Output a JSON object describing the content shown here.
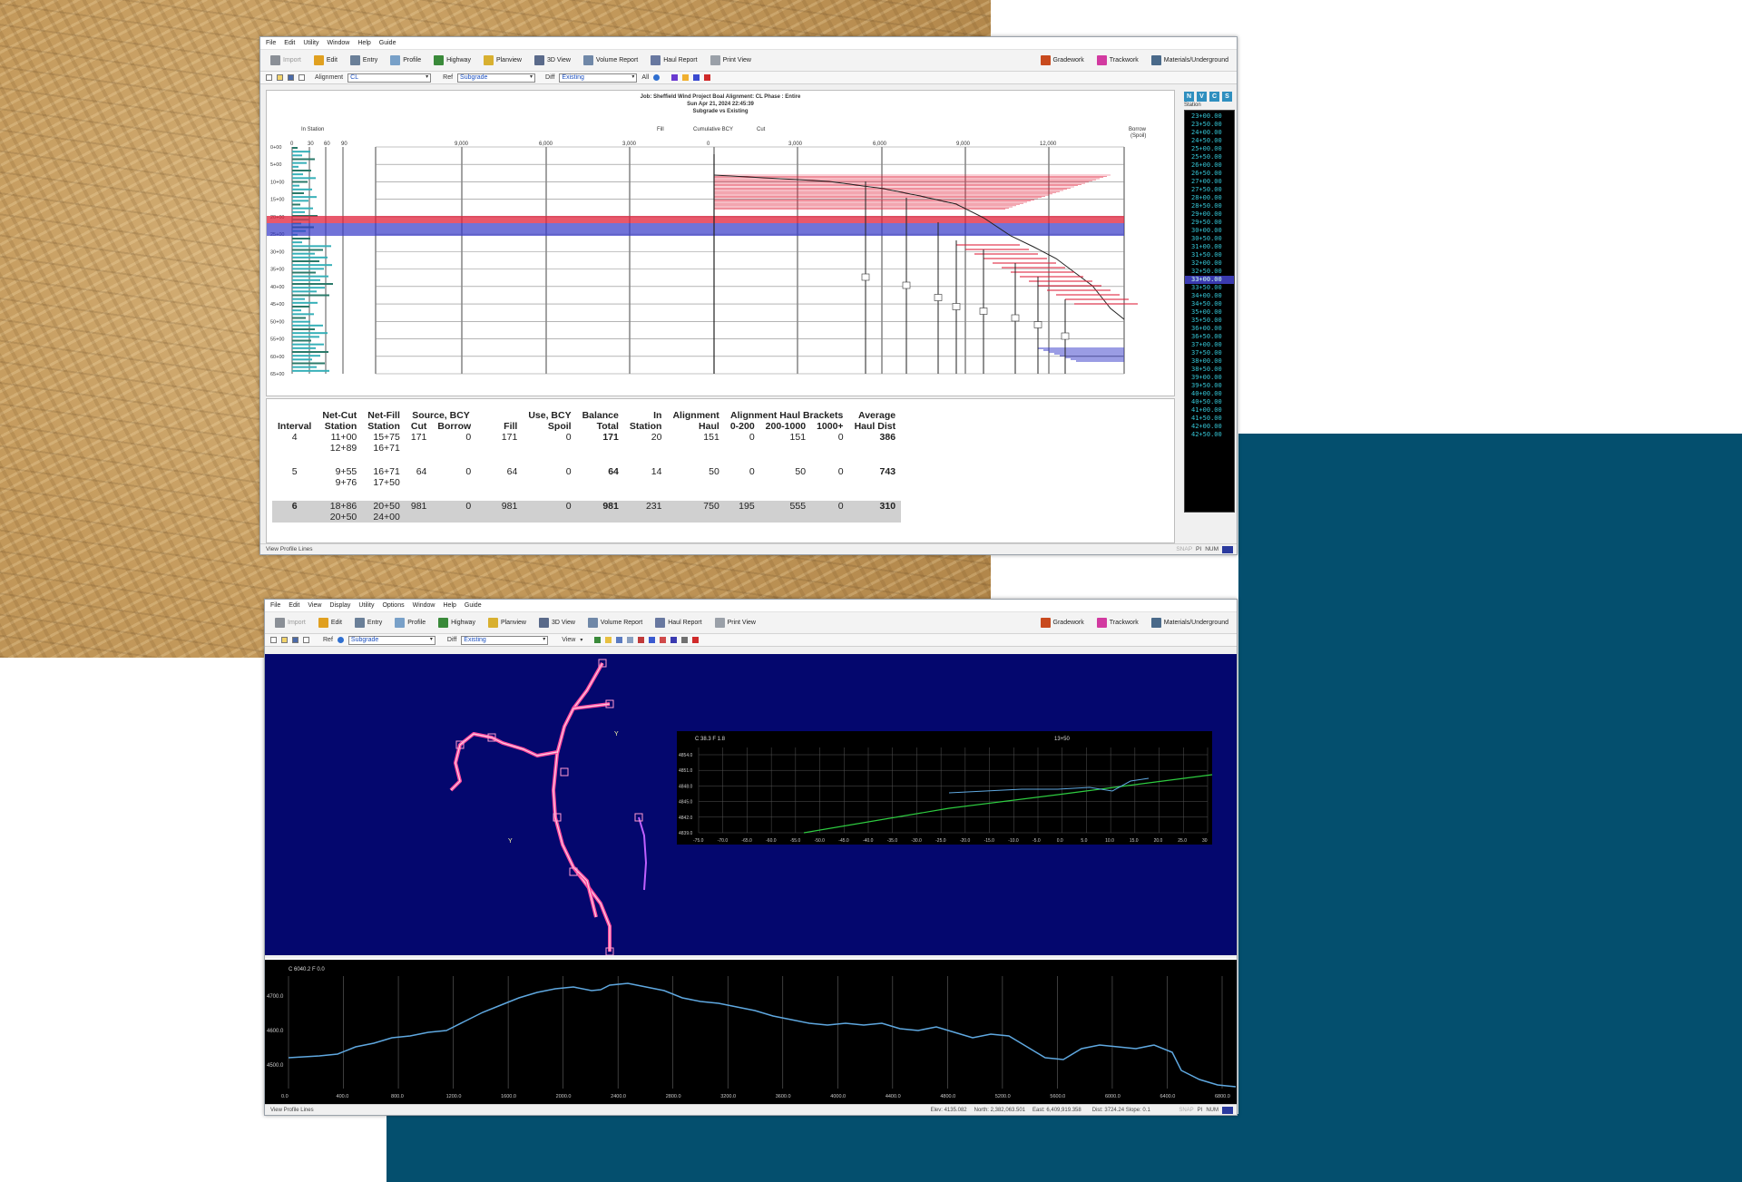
{
  "window1": {
    "menu": [
      "File",
      "Edit",
      "Utility",
      "Window",
      "Help",
      "Guide"
    ],
    "toolbar": [
      "Import",
      "Edit",
      "Entry",
      "Profile",
      "Highway",
      "Planview",
      "3D View",
      "Volume Report",
      "Haul Report",
      "Print View"
    ],
    "toolbar_right": [
      "Gradework",
      "Trackwork",
      "Materials/Underground"
    ],
    "options": {
      "alignment_label": "Alignment",
      "alignment_value": "CL",
      "ref_label": "Ref",
      "ref_value": "Subgrade",
      "diff_label": "Diff",
      "diff_value": "Existing",
      "all_label": "All"
    },
    "mass_header": {
      "line1": "Job: Sheffield Wind Project Boal   Alignment: CL    Phase : Entire",
      "line2": "Sun Apr 21, 2024 22:45:39",
      "line3": "Subgrade vs Existing"
    },
    "mass_labels": {
      "in_station": "In Station",
      "fill": "Fill",
      "cumulative": "Cumulative BCY",
      "cut": "Cut",
      "borrow": "Borrow",
      "spoil": "(Spoil)"
    },
    "mass_ticks_left": [
      "0",
      "30",
      "60",
      "90"
    ],
    "mass_ticks_fill": [
      "9,000",
      "6,000",
      "3,000",
      "0"
    ],
    "mass_ticks_cut": [
      "3,000",
      "6,000",
      "9,000",
      "12,000"
    ],
    "station_ticks": [
      "0+00",
      "5+00",
      "10+00",
      "15+00",
      "20+00",
      "25+00",
      "30+00",
      "35+00",
      "40+00",
      "45+00",
      "50+00",
      "55+00",
      "60+00",
      "65+00"
    ],
    "report": {
      "headers": {
        "interval": "Interval",
        "netcut_top": "Net-Cut",
        "netcut_bot": "Station",
        "netfill_top": "Net-Fill",
        "netfill_bot": "Station",
        "source_top": "Source, BCY",
        "cut": "Cut",
        "borrow": "Borrow",
        "fill": "Fill",
        "use_top": "Use, BCY",
        "spoil": "Spoil",
        "balance_top": "Balance",
        "balance_bot": "Total",
        "in_top": "In",
        "in_bot": "Station",
        "alhaul_top": "Alignment",
        "alhaul_bot": "Haul",
        "brackets_top": "Alignment Haul Brackets",
        "b1": "0-200",
        "b2": "200-1000",
        "b3": "1000+",
        "avg_top": "Average",
        "avg_bot": "Haul Dist"
      },
      "rows": [
        {
          "interval": "4",
          "netcut": [
            "11+00",
            "12+89"
          ],
          "netfill": [
            "15+75",
            "16+71"
          ],
          "cut": "171",
          "borrow": "0",
          "fill": "171",
          "spoil": "0",
          "balance": "171",
          "in_station": "20",
          "alhaul": "151",
          "b1": "0",
          "b2": "151",
          "b3": "0",
          "avg": "386"
        },
        {
          "interval": "5",
          "netcut": [
            "9+55",
            "9+76"
          ],
          "netfill": [
            "16+71",
            "17+50"
          ],
          "cut": "64",
          "borrow": "0",
          "fill": "64",
          "spoil": "0",
          "balance": "64",
          "in_station": "14",
          "alhaul": "50",
          "b1": "0",
          "b2": "50",
          "b3": "0",
          "avg": "743"
        },
        {
          "interval": "6",
          "netcut": [
            "18+86",
            "20+50"
          ],
          "netfill": [
            "20+50",
            "24+00"
          ],
          "cut": "981",
          "borrow": "0",
          "fill": "981",
          "spoil": "0",
          "balance": "981",
          "in_station": "231",
          "alhaul": "750",
          "b1": "195",
          "b2": "555",
          "b3": "0",
          "avg": "310"
        }
      ]
    },
    "station_panel": {
      "icons": [
        "N",
        "V",
        "C",
        "S"
      ],
      "label": "Station",
      "items": [
        "23+00.00",
        "23+50.00",
        "24+00.00",
        "24+50.00",
        "25+00.00",
        "25+50.00",
        "26+00.00",
        "26+50.00",
        "27+00.00",
        "27+50.00",
        "28+00.00",
        "28+50.00",
        "29+00.00",
        "29+50.00",
        "30+00.00",
        "30+50.00",
        "31+00.00",
        "31+50.00",
        "32+00.00",
        "32+50.00",
        "33+00.00",
        "33+50.00",
        "34+00.00",
        "34+50.00",
        "35+00.00",
        "35+50.00",
        "36+00.00",
        "36+50.00",
        "37+00.00",
        "37+50.00",
        "38+00.00",
        "38+50.00",
        "39+00.00",
        "39+50.00",
        "40+00.00",
        "40+50.00",
        "41+00.00",
        "41+50.00",
        "42+00.00",
        "42+50.00"
      ],
      "selected_index": 20
    },
    "status": {
      "left": "View Profile Lines",
      "right1": "SNAP",
      "right2": "PI",
      "right3": "NUM"
    }
  },
  "window2": {
    "menu": [
      "File",
      "Edit",
      "View",
      "Display",
      "Utility",
      "Options",
      "Window",
      "Help",
      "Guide"
    ],
    "toolbar": [
      "Import",
      "Edit",
      "Entry",
      "Profile",
      "Highway",
      "Planview",
      "3D View",
      "Volume Report",
      "Haul Report",
      "Print View"
    ],
    "toolbar_right": [
      "Gradework",
      "Trackwork",
      "Materials/Underground"
    ],
    "options": {
      "ref_label": "Ref",
      "ref_value": "Subgrade",
      "diff_label": "Diff",
      "diff_value": "Existing",
      "view_label": "View"
    },
    "section_header_left": "C 38.3  F 1.8",
    "section_header_right": "13+50",
    "section_y_ticks": [
      "4854.0",
      "4851.0",
      "4848.0",
      "4845.0",
      "4842.0",
      "4839.0"
    ],
    "section_x_ticks": [
      "-75.0",
      "-70.0",
      "-65.0",
      "-60.0",
      "-55.0",
      "-50.0",
      "-45.0",
      "-40.0",
      "-35.0",
      "-30.0",
      "-25.0",
      "-20.0",
      "-15.0",
      "-10.0",
      "-5.0",
      "0.0",
      "5.0",
      "10.0",
      "15.0",
      "20.0",
      "25.0",
      "30"
    ],
    "profile_header": "C 6040.2   F 0.0",
    "profile_y_ticks": [
      "4700.0",
      "4600.0",
      "4500.0"
    ],
    "profile_x_ticks": [
      "0.0",
      "400.0",
      "800.0",
      "1200.0",
      "1600.0",
      "2000.0",
      "2400.0",
      "2800.0",
      "3200.0",
      "3600.0",
      "4000.0",
      "4400.0",
      "4800.0",
      "5200.0",
      "5600.0",
      "6000.0",
      "6400.0",
      "6800.0"
    ],
    "status": {
      "left": "View Profile Lines",
      "elev": "Elev: 4135.082",
      "north": "North: 2,382,063.501",
      "east": "East: 6,409,919.358",
      "dist": "Dist: 3724.24 Slope: 0.1",
      "right1": "SNAP",
      "right2": "PI",
      "right3": "NUM"
    }
  },
  "colors": {
    "teal": "#044f6e",
    "plan_bg": "#04076e",
    "profile_line": "#5fa8e0",
    "section_green": "#2ecc40",
    "fill_red": "#e0203a",
    "cut_blue": "#3438c8",
    "station_text": "#35c6d6"
  }
}
